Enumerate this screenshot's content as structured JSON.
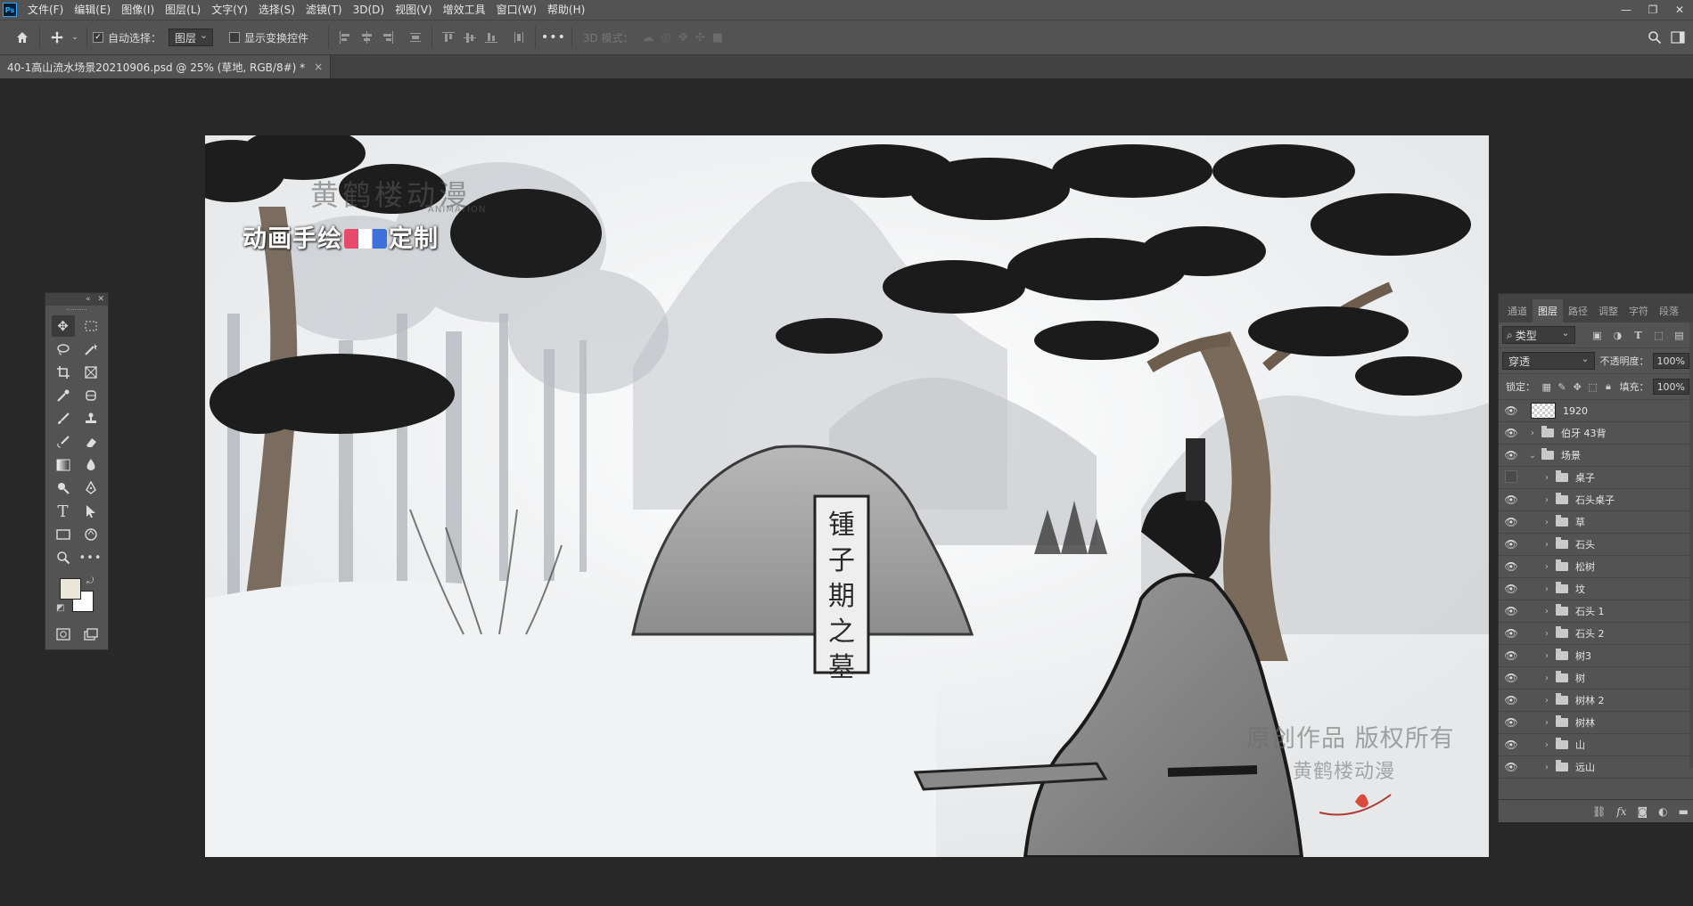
{
  "menubar": {
    "logo": "Ps",
    "items": [
      "文件(F)",
      "编辑(E)",
      "图像(I)",
      "图层(L)",
      "文字(Y)",
      "选择(S)",
      "滤镜(T)",
      "3D(D)",
      "视图(V)",
      "增效工具",
      "窗口(W)",
      "帮助(H)"
    ],
    "window_controls": [
      "—",
      "❐",
      "✕"
    ]
  },
  "options": {
    "auto_select_label": "自动选择：",
    "auto_select_value": "图层",
    "show_transform_label": "显示变换控件",
    "more": "•••",
    "mode3d_label": "3D 模式："
  },
  "tab": {
    "title": "40-1高山流水场景20210906.psd @ 25% (草地, RGB/8#) *",
    "close": "×"
  },
  "artwork": {
    "logo_text": "黄鹤楼动漫",
    "logo_sub": "ANIMATION",
    "slogan_left": "动画手绘",
    "slogan_right": "定制",
    "tomb_text": "锺子期之墓",
    "watermark_line1": "原创作品 版权所有",
    "watermark_line2": "黄鹤楼动漫"
  },
  "layers_panel": {
    "tabs": [
      "通道",
      "图层",
      "路径",
      "调整",
      "字符",
      "段落"
    ],
    "active_tab": "图层",
    "filter_label": "类型",
    "blend_mode": "穿透",
    "opacity_label": "不透明度：",
    "opacity_value": "100%",
    "lock_label": "锁定：",
    "fill_label": "填充：",
    "fill_value": "100%",
    "layers": [
      {
        "name": "1920",
        "kind": "image",
        "visible": true,
        "indent": 0
      },
      {
        "name": "伯牙 43背",
        "kind": "group",
        "visible": true,
        "indent": 0,
        "expanded": false
      },
      {
        "name": "场景",
        "kind": "group",
        "visible": true,
        "indent": 0,
        "expanded": true
      },
      {
        "name": "桌子",
        "kind": "group",
        "visible": false,
        "indent": 1
      },
      {
        "name": "石头桌子",
        "kind": "group",
        "visible": true,
        "indent": 1
      },
      {
        "name": "草",
        "kind": "group",
        "visible": true,
        "indent": 1
      },
      {
        "name": "石头",
        "kind": "group",
        "visible": true,
        "indent": 1
      },
      {
        "name": "松树",
        "kind": "group",
        "visible": true,
        "indent": 1
      },
      {
        "name": "坟",
        "kind": "group",
        "visible": true,
        "indent": 1
      },
      {
        "name": "石头 1",
        "kind": "group",
        "visible": true,
        "indent": 1
      },
      {
        "name": "石头 2",
        "kind": "group",
        "visible": true,
        "indent": 1
      },
      {
        "name": "树3",
        "kind": "group",
        "visible": true,
        "indent": 1
      },
      {
        "name": "树",
        "kind": "group",
        "visible": true,
        "indent": 1
      },
      {
        "name": "树林 2",
        "kind": "group",
        "visible": true,
        "indent": 1
      },
      {
        "name": "树林",
        "kind": "group",
        "visible": true,
        "indent": 1
      },
      {
        "name": "山",
        "kind": "group",
        "visible": true,
        "indent": 1
      },
      {
        "name": "远山",
        "kind": "group",
        "visible": true,
        "indent": 1
      }
    ],
    "footer_icons": [
      "link-icon",
      "fx-icon",
      "mask-icon",
      "adjustment-icon",
      "new-group-icon"
    ]
  },
  "colors": {
    "foreground": "#ebe6da",
    "background": "#ffffff",
    "ui_panel": "#535353",
    "ui_dark": "#282828"
  }
}
